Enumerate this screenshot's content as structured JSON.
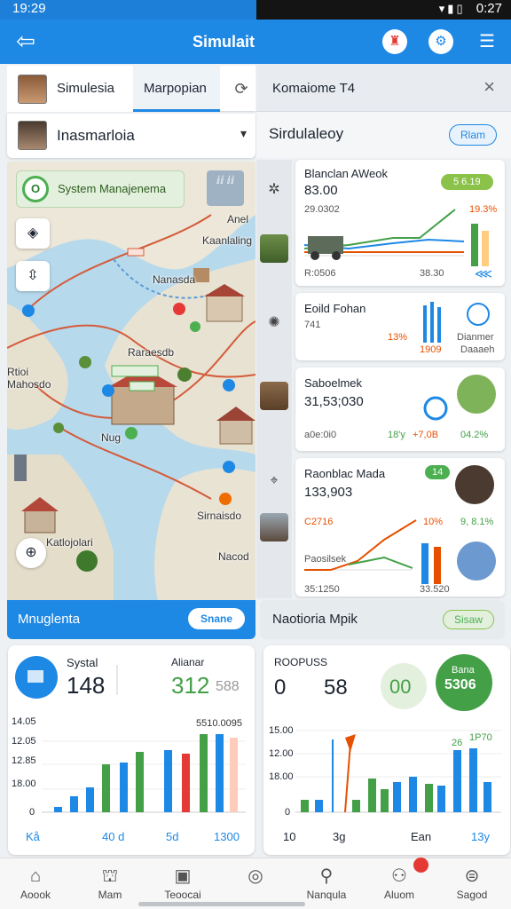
{
  "status": {
    "time_left": "19:29",
    "time_right": "0:27"
  },
  "appbar": {
    "title": "Simulait"
  },
  "tabs": {
    "simulation": "Simulesia",
    "map": "Marpopian"
  },
  "user": {
    "name": "Inasmarloia"
  },
  "map": {
    "chip": "System Manajenema",
    "chip_logo": "O",
    "badge": "ⅈⅈ\nⅈⅈ",
    "labels": [
      "Anel",
      "Kaanlaling",
      "Nanasda",
      "Raraesdb",
      "Rtioi",
      "Mahosdo",
      "Nug",
      "Sirnaisdo",
      "Katlojolari",
      "Nacod"
    ]
  },
  "left_banner": {
    "title": "Mnuglenta",
    "button": "Snane"
  },
  "left_stats": {
    "label": "Systal",
    "value": "148",
    "label2": "Alianar",
    "value2": "312",
    "value2_suffix": "588",
    "value_top": "5510.0095",
    "yticks": [
      "14.05",
      "12.05",
      "12.85",
      "18.00",
      "0"
    ],
    "bottom": [
      "Kå",
      "40 d",
      "5d",
      "1300"
    ]
  },
  "right_head": {
    "title": "Komaiome T4",
    "close": "×"
  },
  "right_sub": {
    "title": "Sirdulaleoy",
    "button": "Rlam"
  },
  "cards": [
    {
      "title": "Blanclan AWeok",
      "value": "83.00",
      "sub": "29.0302",
      "pill": "5 6.19",
      "pct": "19.3%",
      "foot_left": "R:0506",
      "foot_right": "38.30"
    },
    {
      "title": "Eoild Fohan",
      "sub": "741",
      "pct": "13%",
      "mid": "1909",
      "r1": "Dianmer",
      "r2": "Daaaeh"
    },
    {
      "title": "Saboelmek",
      "value": "31,53;030",
      "foot_left": "a0e:0i0",
      "foot_mid": "18'y",
      "foot_mid2": "+7,0B",
      "foot_right": "04.2%"
    },
    {
      "title": "Raonblac Mada",
      "value": "133,903",
      "pill": "14",
      "red": "C2716",
      "pct1": "10%",
      "pct2": "9, 8.1%",
      "bottom_left": "Paosilsek",
      "bottom_mid": "35:1250",
      "bottom_right": "33.520"
    }
  ],
  "right_banner": {
    "title": "Naotioria Mpik",
    "button": "Sisaw"
  },
  "right_stats": {
    "label": "ROOPUSS",
    "value": "0",
    "value2": "58",
    "circle1": "00",
    "circle2_top": "Bana",
    "circle2": "5306",
    "yticks": [
      "15.00",
      "12.00",
      "18.00",
      "0"
    ],
    "top_labels": [
      "26",
      "1P70"
    ],
    "bottom": [
      "10",
      "3g",
      "Ean",
      "13y"
    ]
  },
  "bottom_nav": [
    {
      "label": "Aoook",
      "icon": "home-icon"
    },
    {
      "label": "Mam",
      "icon": "map-icon"
    },
    {
      "label": "Teoocai",
      "icon": "tablet-icon"
    },
    {
      "label": "",
      "icon": "circle-icon"
    },
    {
      "label": "Nanqula",
      "icon": "search-icon"
    },
    {
      "label": "Aluom",
      "icon": "activity-icon"
    },
    {
      "label": "Sagod",
      "icon": "profile-icon"
    }
  ],
  "colors": {
    "primary": "#1e88e5",
    "green": "#4caf50",
    "orange": "#e65100",
    "red": "#e53935"
  }
}
